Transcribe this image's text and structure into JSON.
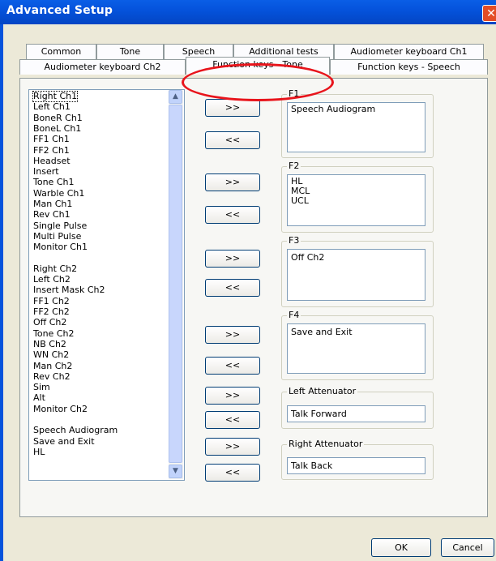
{
  "window": {
    "title": "Advanced Setup",
    "close_symbol": "✕"
  },
  "tabs_row1": [
    {
      "label": "Common"
    },
    {
      "label": "Tone"
    },
    {
      "label": "Speech"
    },
    {
      "label": "Additional tests"
    },
    {
      "label": "Audiometer keyboard Ch1"
    }
  ],
  "tabs_row2": [
    {
      "label": "Audiometer keyboard Ch2"
    },
    {
      "label": "Function keys - Tone"
    },
    {
      "label": "Function keys - Speech"
    }
  ],
  "list": {
    "items": [
      "Right Ch1",
      "Left Ch1",
      "BoneR Ch1",
      "BoneL Ch1",
      "FF1 Ch1",
      "FF2 Ch1",
      "Headset",
      "Insert",
      "Tone Ch1",
      "Warble Ch1",
      "Man Ch1",
      "Rev Ch1",
      "Single Pulse",
      "Multi Pulse",
      "Monitor Ch1",
      "",
      "Right Ch2",
      "Left Ch2",
      "Insert Mask Ch2",
      "FF1 Ch2",
      "FF2 Ch2",
      "Off Ch2",
      "Tone Ch2",
      "NB Ch2",
      "WN Ch2",
      "Man Ch2",
      "Rev Ch2",
      "Sim",
      "Alt",
      "Monitor Ch2",
      "",
      "Speech Audiogram",
      "Save and Exit",
      "HL"
    ],
    "selected": "Right Ch1",
    "scroll_up_symbol": "▲",
    "scroll_down_symbol": "▼"
  },
  "add_label": ">>",
  "remove_label": "<<",
  "groups": {
    "f1": {
      "label": "F1",
      "items": [
        "Speech Audiogram"
      ]
    },
    "f2": {
      "label": "F2",
      "items": [
        "HL",
        "MCL",
        "UCL"
      ]
    },
    "f3": {
      "label": "F3",
      "items": [
        "Off Ch2"
      ]
    },
    "f4": {
      "label": "F4",
      "items": [
        "Save and Exit"
      ]
    },
    "left_att": {
      "label": "Left Attenuator",
      "value": "Talk Forward"
    },
    "right_att": {
      "label": "Right Attenuator",
      "value": "Talk Back"
    }
  },
  "ok_label": "OK",
  "cancel_label": "Cancel",
  "annotation_color": "#e8141b"
}
